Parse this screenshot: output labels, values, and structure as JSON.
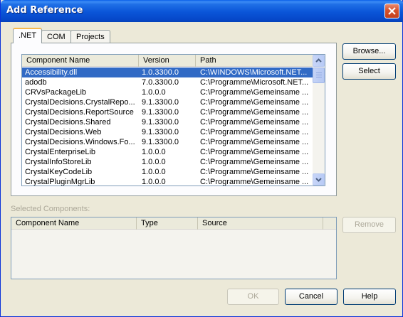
{
  "window": {
    "title": "Add Reference"
  },
  "tabs": [
    {
      "label": ".NET",
      "active": true
    },
    {
      "label": "COM",
      "active": false
    },
    {
      "label": "Projects",
      "active": false
    }
  ],
  "components": {
    "columns": [
      "Component Name",
      "Version",
      "Path"
    ],
    "rows": [
      {
        "name": "Accessibility.dll",
        "version": "1.0.3300.0",
        "path": "C:\\WINDOWS\\Microsoft.NET...",
        "selected": true
      },
      {
        "name": "adodb",
        "version": "7.0.3300.0",
        "path": "C:\\Programme\\Microsoft.NET..."
      },
      {
        "name": "CRVsPackageLib",
        "version": "1.0.0.0",
        "path": "C:\\Programme\\Gemeinsame ..."
      },
      {
        "name": "CrystalDecisions.CrystalRepo...",
        "version": "9.1.3300.0",
        "path": "C:\\Programme\\Gemeinsame ..."
      },
      {
        "name": "CrystalDecisions.ReportSource",
        "version": "9.1.3300.0",
        "path": "C:\\Programme\\Gemeinsame ..."
      },
      {
        "name": "CrystalDecisions.Shared",
        "version": "9.1.3300.0",
        "path": "C:\\Programme\\Gemeinsame ..."
      },
      {
        "name": "CrystalDecisions.Web",
        "version": "9.1.3300.0",
        "path": "C:\\Programme\\Gemeinsame ..."
      },
      {
        "name": "CrystalDecisions.Windows.Fo...",
        "version": "9.1.3300.0",
        "path": "C:\\Programme\\Gemeinsame ..."
      },
      {
        "name": "CrystalEnterpriseLib",
        "version": "1.0.0.0",
        "path": "C:\\Programme\\Gemeinsame ..."
      },
      {
        "name": "CrystalInfoStoreLib",
        "version": "1.0.0.0",
        "path": "C:\\Programme\\Gemeinsame ..."
      },
      {
        "name": "CrystalKeyCodeLib",
        "version": "1.0.0.0",
        "path": "C:\\Programme\\Gemeinsame ..."
      },
      {
        "name": "CrystalPluginMgrLib",
        "version": "1.0.0.0",
        "path": "C:\\Programme\\Gemeinsame ..."
      }
    ]
  },
  "side_buttons": {
    "browse": "Browse...",
    "select": "Select",
    "remove": "Remove"
  },
  "selected_components": {
    "label": "Selected Components:",
    "columns": [
      "Component Name",
      "Type",
      "Source"
    ]
  },
  "footer_buttons": {
    "ok": "OK",
    "cancel": "Cancel",
    "help": "Help"
  },
  "colors": {
    "titlebar": "#0a55d8",
    "selection": "#316ac5",
    "dialog_bg": "#ece9d8",
    "close_button": "#d6512c",
    "active_tab_accent": "#f7b84c"
  }
}
